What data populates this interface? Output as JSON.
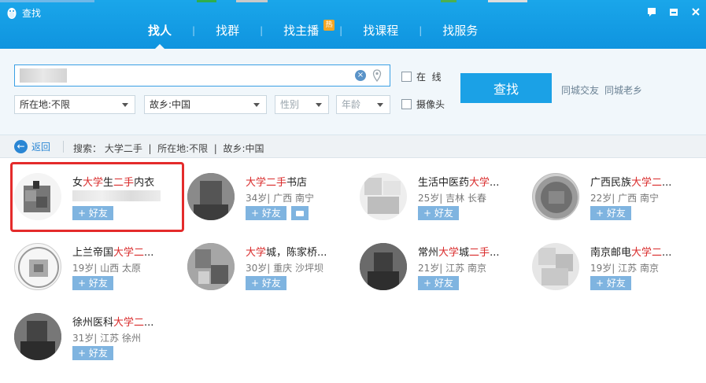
{
  "window": {
    "title": "查找"
  },
  "tabs": [
    {
      "label": "找人",
      "active": true
    },
    {
      "label": "找群"
    },
    {
      "label": "找主播",
      "badge": "热"
    },
    {
      "label": "找课程"
    },
    {
      "label": "找服务"
    }
  ],
  "search": {
    "input_value": "",
    "online_label": "在  线",
    "camera_label": "摄像头",
    "button_label": "查找",
    "link_city_friends": "同城交友",
    "link_city_hometown": "同城老乡",
    "location": "所在地:不限",
    "hometown": "故乡:中国",
    "gender": "性别",
    "age": "年龄"
  },
  "breadcrumb": {
    "back_label": "返回",
    "text": "搜索： 大学二手  |  所在地:不限  |  故乡:中国"
  },
  "results": [
    {
      "name_parts": [
        "女",
        "大学",
        "生",
        "二手",
        "内衣"
      ],
      "meta": "",
      "add_label": "+ 好友",
      "has_msg": false
    },
    {
      "name_parts": [
        "",
        "大学二手",
        "书店"
      ],
      "meta": "34岁| 广西 南宁",
      "add_label": "+ 好友",
      "has_msg": true
    },
    {
      "name_parts": [
        "生活中医药",
        "大学",
        "..."
      ],
      "meta": "25岁| 吉林 长春",
      "add_label": "+ 好友",
      "has_msg": false
    },
    {
      "name_parts": [
        "广西民族",
        "大学二",
        "..."
      ],
      "meta": "22岁| 广西 南宁",
      "add_label": "+ 好友",
      "has_msg": false
    },
    {
      "name_parts": [
        "上兰帝国",
        "大学二",
        "..."
      ],
      "meta": "19岁| 山西 太原",
      "add_label": "+ 好友",
      "has_msg": false
    },
    {
      "name_parts": [
        "",
        "大学",
        "城，陈家桥..."
      ],
      "meta": "30岁| 重庆 沙坪坝",
      "add_label": "+ 好友",
      "has_msg": false
    },
    {
      "name_parts": [
        "常州",
        "大学",
        "城",
        "二手",
        "..."
      ],
      "meta": "21岁| 江苏 南京",
      "add_label": "+ 好友",
      "has_msg": false
    },
    {
      "name_parts": [
        "南京邮电",
        "大学二",
        "..."
      ],
      "meta": "19岁| 江苏 南京",
      "add_label": "+ 好友",
      "has_msg": false
    },
    {
      "name_parts": [
        "徐州医科",
        "大学二",
        "..."
      ],
      "meta": "31岁| 江苏 徐州",
      "add_label": "+ 好友",
      "has_msg": false
    }
  ],
  "colors": {
    "accent": "#1ba1e6",
    "highlight": "#d92b2b"
  }
}
